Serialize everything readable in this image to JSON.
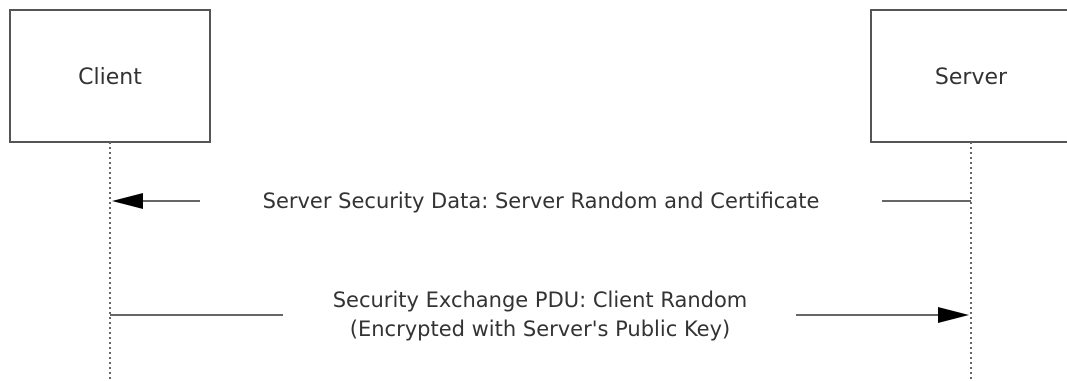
{
  "participants": {
    "client": {
      "label": "Client"
    },
    "server": {
      "label": "Server"
    }
  },
  "messages": [
    {
      "direction": "server-to-client",
      "lines": [
        "Server Security Data: Server Random and Certificate"
      ]
    },
    {
      "direction": "client-to-server",
      "lines": [
        "Security Exchange PDU: Client Random",
        "(Encrypted with Server's Public Key)"
      ]
    }
  ]
}
